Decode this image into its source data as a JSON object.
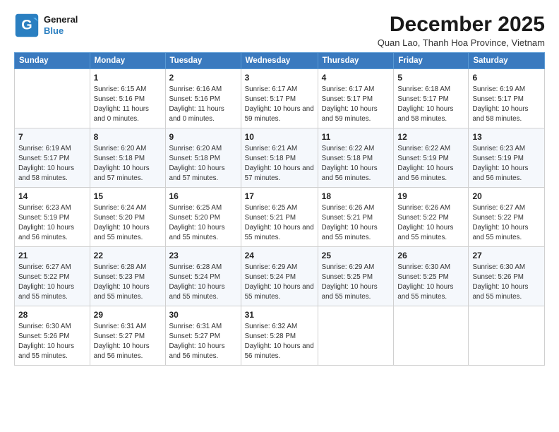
{
  "logo": {
    "line1": "General",
    "line2": "Blue"
  },
  "title": "December 2025",
  "location": "Quan Lao, Thanh Hoa Province, Vietnam",
  "header": {
    "days": [
      "Sunday",
      "Monday",
      "Tuesday",
      "Wednesday",
      "Thursday",
      "Friday",
      "Saturday"
    ]
  },
  "weeks": [
    [
      {
        "day": "",
        "info": ""
      },
      {
        "day": "1",
        "info": "Sunrise: 6:15 AM\nSunset: 5:16 PM\nDaylight: 11 hours\nand 0 minutes."
      },
      {
        "day": "2",
        "info": "Sunrise: 6:16 AM\nSunset: 5:16 PM\nDaylight: 11 hours\nand 0 minutes."
      },
      {
        "day": "3",
        "info": "Sunrise: 6:17 AM\nSunset: 5:17 PM\nDaylight: 10 hours\nand 59 minutes."
      },
      {
        "day": "4",
        "info": "Sunrise: 6:17 AM\nSunset: 5:17 PM\nDaylight: 10 hours\nand 59 minutes."
      },
      {
        "day": "5",
        "info": "Sunrise: 6:18 AM\nSunset: 5:17 PM\nDaylight: 10 hours\nand 58 minutes."
      },
      {
        "day": "6",
        "info": "Sunrise: 6:19 AM\nSunset: 5:17 PM\nDaylight: 10 hours\nand 58 minutes."
      }
    ],
    [
      {
        "day": "7",
        "info": "Sunrise: 6:19 AM\nSunset: 5:17 PM\nDaylight: 10 hours\nand 58 minutes."
      },
      {
        "day": "8",
        "info": "Sunrise: 6:20 AM\nSunset: 5:18 PM\nDaylight: 10 hours\nand 57 minutes."
      },
      {
        "day": "9",
        "info": "Sunrise: 6:20 AM\nSunset: 5:18 PM\nDaylight: 10 hours\nand 57 minutes."
      },
      {
        "day": "10",
        "info": "Sunrise: 6:21 AM\nSunset: 5:18 PM\nDaylight: 10 hours\nand 57 minutes."
      },
      {
        "day": "11",
        "info": "Sunrise: 6:22 AM\nSunset: 5:18 PM\nDaylight: 10 hours\nand 56 minutes."
      },
      {
        "day": "12",
        "info": "Sunrise: 6:22 AM\nSunset: 5:19 PM\nDaylight: 10 hours\nand 56 minutes."
      },
      {
        "day": "13",
        "info": "Sunrise: 6:23 AM\nSunset: 5:19 PM\nDaylight: 10 hours\nand 56 minutes."
      }
    ],
    [
      {
        "day": "14",
        "info": "Sunrise: 6:23 AM\nSunset: 5:19 PM\nDaylight: 10 hours\nand 56 minutes."
      },
      {
        "day": "15",
        "info": "Sunrise: 6:24 AM\nSunset: 5:20 PM\nDaylight: 10 hours\nand 55 minutes."
      },
      {
        "day": "16",
        "info": "Sunrise: 6:25 AM\nSunset: 5:20 PM\nDaylight: 10 hours\nand 55 minutes."
      },
      {
        "day": "17",
        "info": "Sunrise: 6:25 AM\nSunset: 5:21 PM\nDaylight: 10 hours\nand 55 minutes."
      },
      {
        "day": "18",
        "info": "Sunrise: 6:26 AM\nSunset: 5:21 PM\nDaylight: 10 hours\nand 55 minutes."
      },
      {
        "day": "19",
        "info": "Sunrise: 6:26 AM\nSunset: 5:22 PM\nDaylight: 10 hours\nand 55 minutes."
      },
      {
        "day": "20",
        "info": "Sunrise: 6:27 AM\nSunset: 5:22 PM\nDaylight: 10 hours\nand 55 minutes."
      }
    ],
    [
      {
        "day": "21",
        "info": "Sunrise: 6:27 AM\nSunset: 5:22 PM\nDaylight: 10 hours\nand 55 minutes."
      },
      {
        "day": "22",
        "info": "Sunrise: 6:28 AM\nSunset: 5:23 PM\nDaylight: 10 hours\nand 55 minutes."
      },
      {
        "day": "23",
        "info": "Sunrise: 6:28 AM\nSunset: 5:24 PM\nDaylight: 10 hours\nand 55 minutes."
      },
      {
        "day": "24",
        "info": "Sunrise: 6:29 AM\nSunset: 5:24 PM\nDaylight: 10 hours\nand 55 minutes."
      },
      {
        "day": "25",
        "info": "Sunrise: 6:29 AM\nSunset: 5:25 PM\nDaylight: 10 hours\nand 55 minutes."
      },
      {
        "day": "26",
        "info": "Sunrise: 6:30 AM\nSunset: 5:25 PM\nDaylight: 10 hours\nand 55 minutes."
      },
      {
        "day": "27",
        "info": "Sunrise: 6:30 AM\nSunset: 5:26 PM\nDaylight: 10 hours\nand 55 minutes."
      }
    ],
    [
      {
        "day": "28",
        "info": "Sunrise: 6:30 AM\nSunset: 5:26 PM\nDaylight: 10 hours\nand 55 minutes."
      },
      {
        "day": "29",
        "info": "Sunrise: 6:31 AM\nSunset: 5:27 PM\nDaylight: 10 hours\nand 56 minutes."
      },
      {
        "day": "30",
        "info": "Sunrise: 6:31 AM\nSunset: 5:27 PM\nDaylight: 10 hours\nand 56 minutes."
      },
      {
        "day": "31",
        "info": "Sunrise: 6:32 AM\nSunset: 5:28 PM\nDaylight: 10 hours\nand 56 minutes."
      },
      {
        "day": "",
        "info": ""
      },
      {
        "day": "",
        "info": ""
      },
      {
        "day": "",
        "info": ""
      }
    ]
  ]
}
